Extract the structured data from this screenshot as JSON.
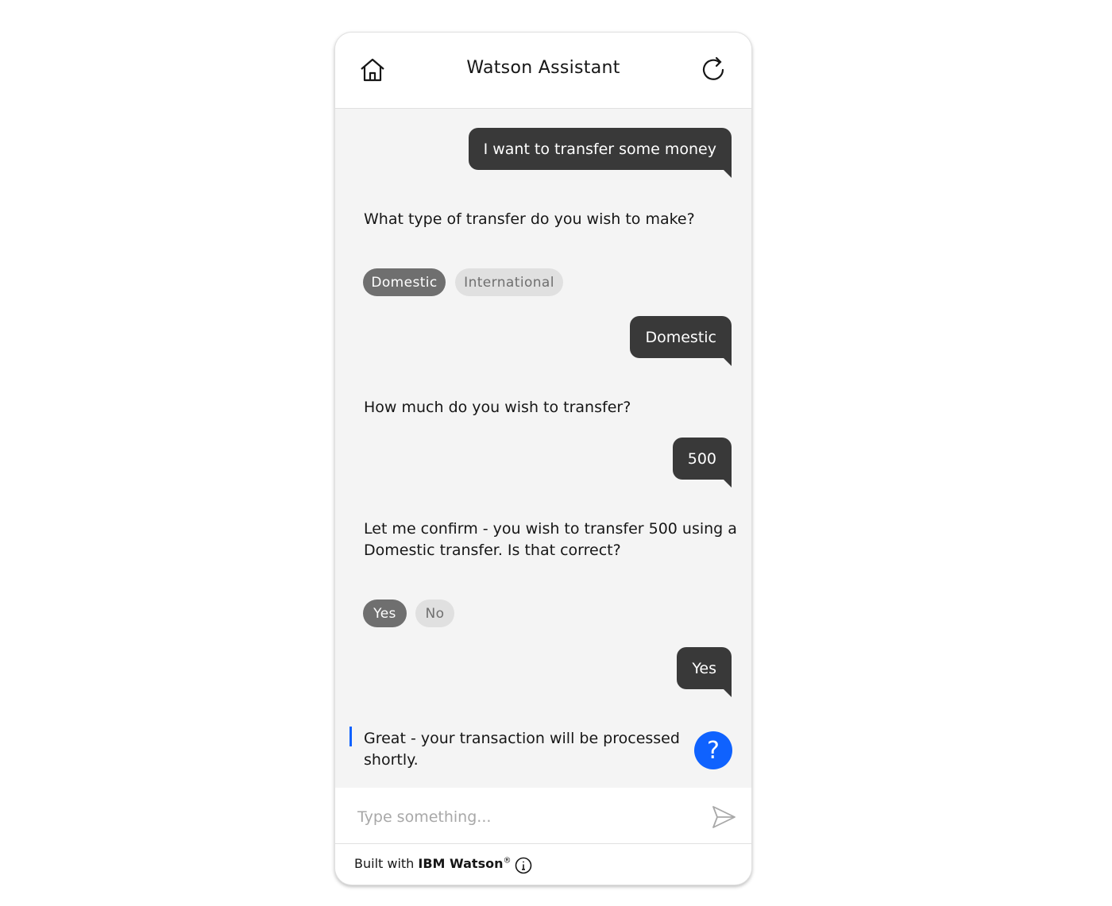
{
  "header": {
    "title": "Watson Assistant"
  },
  "icons": {
    "home": "home-icon",
    "refresh": "refresh-icon",
    "help": "help-icon",
    "send": "send-icon",
    "info": "info-icon"
  },
  "messages": {
    "user_1": "I want to transfer some money",
    "bot_1": "What type of transfer do you wish to make?",
    "options_1": [
      "Domestic",
      "International"
    ],
    "user_2": "Domestic",
    "bot_2": "How much do you wish to transfer?",
    "user_3": "500",
    "bot_3_line1": "Let me confirm - you wish to transfer 500 using a",
    "bot_3_line2": "Domestic transfer. Is that correct?",
    "options_2": [
      "Yes",
      "No"
    ],
    "user_4": "Yes",
    "bot_4_line1": "Great - your transaction will be processed",
    "bot_4_line2": "shortly."
  },
  "help": {
    "label": "?"
  },
  "composer": {
    "placeholder": "Type something..."
  },
  "footer": {
    "prefix": "Built with ",
    "brand": "IBM Watson",
    "mark": "®"
  },
  "colors": {
    "accent": "#0f62fe",
    "bubble": "#393939",
    "chip_selected": "#6f6f6f",
    "chip_unselected": "#e0e0e0"
  }
}
